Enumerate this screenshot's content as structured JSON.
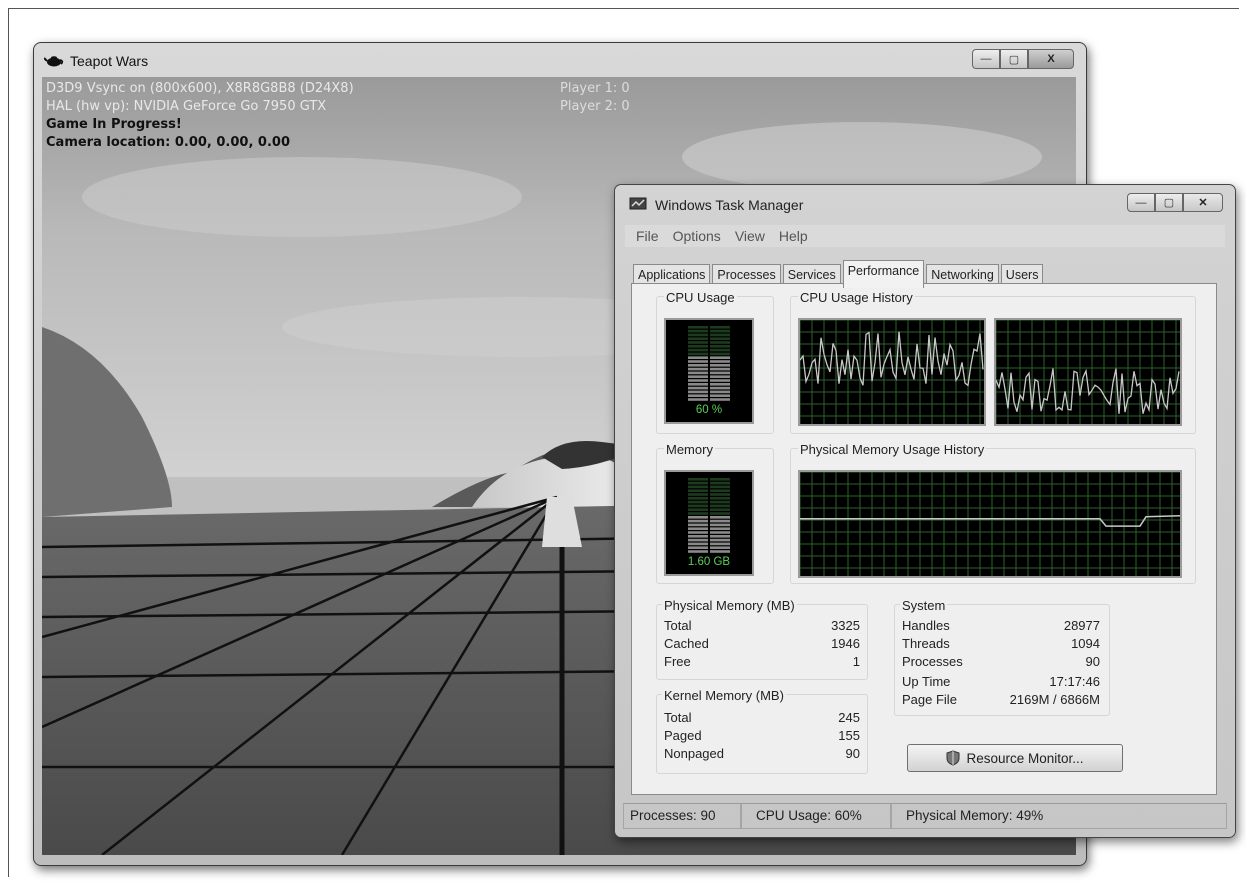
{
  "game_window": {
    "title": "Teapot Wars",
    "hud": {
      "line1": "D3D9 Vsync on (800x600), X8R8G8B8 (D24X8)",
      "line2": "HAL (hw vp): NVIDIA GeForce Go 7950 GTX",
      "status": "Game In Progress!",
      "camera": "Camera location: 0.00, 0.00, 0.00",
      "player1": "Player 1: 0",
      "player2": "Player 2: 0"
    }
  },
  "task_manager": {
    "title": "Windows Task Manager",
    "menu": [
      "File",
      "Options",
      "View",
      "Help"
    ],
    "tabs": [
      "Applications",
      "Processes",
      "Services",
      "Performance",
      "Networking",
      "Users"
    ],
    "active_tab": "Performance",
    "cpu_usage_label": "CPU Usage",
    "cpu_usage_value": "60 %",
    "cpu_fraction": 0.6,
    "cpu_history_label": "CPU Usage History",
    "memory_label": "Memory",
    "memory_value": "1.60 GB",
    "memory_fraction": 0.49,
    "phys_history_label": "Physical Memory Usage History",
    "physical_memory": {
      "heading": "Physical Memory (MB)",
      "rows": [
        {
          "label": "Total",
          "value": "3325"
        },
        {
          "label": "Cached",
          "value": "1946"
        },
        {
          "label": "Free",
          "value": "1"
        }
      ]
    },
    "kernel_memory": {
      "heading": "Kernel Memory (MB)",
      "rows": [
        {
          "label": "Total",
          "value": "245"
        },
        {
          "label": "Paged",
          "value": "155"
        },
        {
          "label": "Nonpaged",
          "value": "90"
        }
      ]
    },
    "system": {
      "heading": "System",
      "rows": [
        {
          "label": "Handles",
          "value": "28977"
        },
        {
          "label": "Threads",
          "value": "1094"
        },
        {
          "label": "Processes",
          "value": "90"
        },
        {
          "label": "Up Time",
          "value": "17:17:46"
        },
        {
          "label": "Page File",
          "value": "2169M / 6866M"
        }
      ]
    },
    "resource_monitor_button": "Resource Monitor...",
    "status_bar": {
      "processes": "Processes: 90",
      "cpu": "CPU Usage: 60%",
      "memory": "Physical Memory: 49%"
    }
  }
}
